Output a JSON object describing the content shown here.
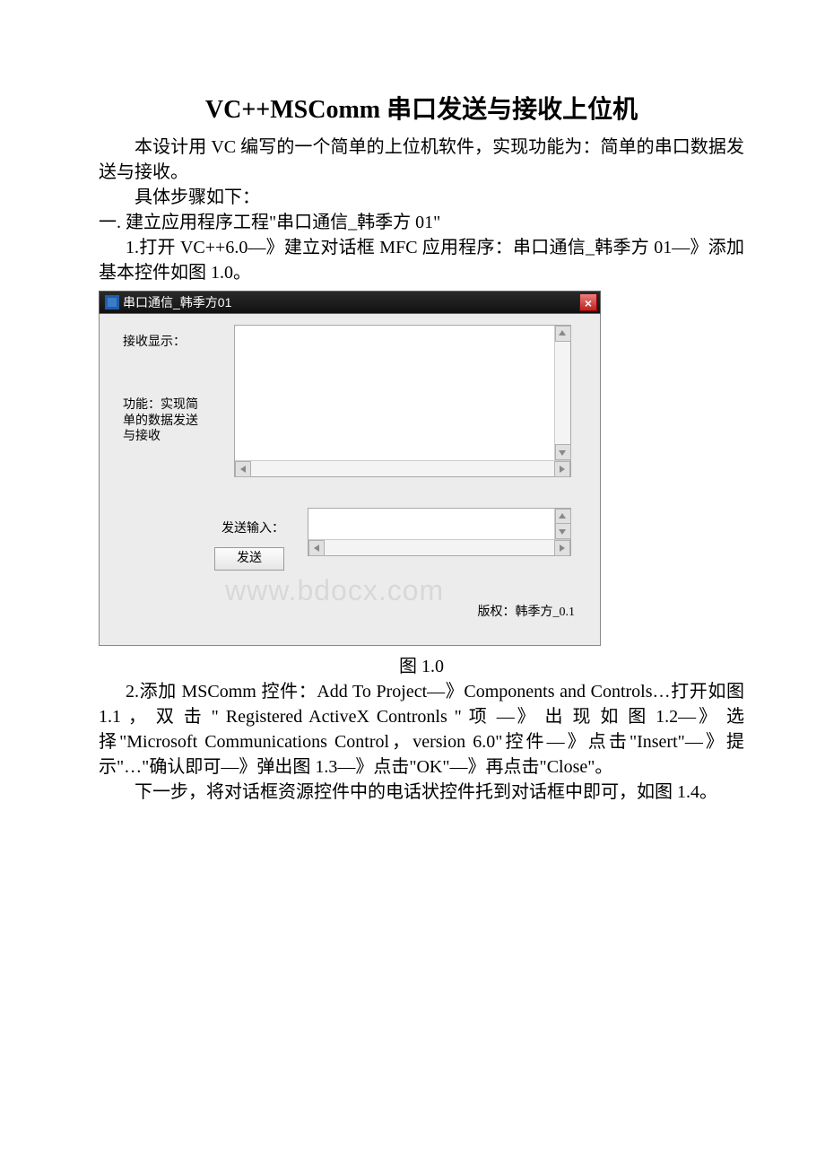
{
  "title": "VC++MSComm 串口发送与接收上位机",
  "intro": "本设计用 VC 编写的一个简单的上位机软件，实现功能为：简单的串口数据发送与接收。",
  "steps_intro": "具体步骤如下：",
  "sec1_heading": "一. 建立应用程序工程\"串口通信_韩季方 01\"",
  "sec1_step1": "1.打开 VC++6.0—》建立对话框 MFC 应用程序：串口通信_韩季方 01—》添加基本控件如图 1.0。",
  "dialog": {
    "window_title": "串口通信_韩季方01",
    "label_receive": "接收显示：",
    "label_desc": "功能：实现简单的数据发送与接收",
    "label_send_input": "发送输入：",
    "btn_send": "发送",
    "watermark": "www.bdocx.com",
    "copyright": "版权：韩季方_0.1"
  },
  "fig1_caption": "图 1.0",
  "sec1_step2": "2.添加 MSComm 控件：Add To Project—》Components and Controls…打开如图 1.1 ， 双 击 \" Registered ActiveX Contronls \" 项 —》 出 现 如 图 1.2—》 选 择\"Microsoft Communications Control，version 6.0\"控件—》点击\"Insert\"—》提示\"…\"确认即可—》弹出图 1.3—》点击\"OK\"—》再点击\"Close\"。",
  "sec1_step3": "下一步，将对话框资源控件中的电话状控件托到对话框中即可，如图 1.4。"
}
